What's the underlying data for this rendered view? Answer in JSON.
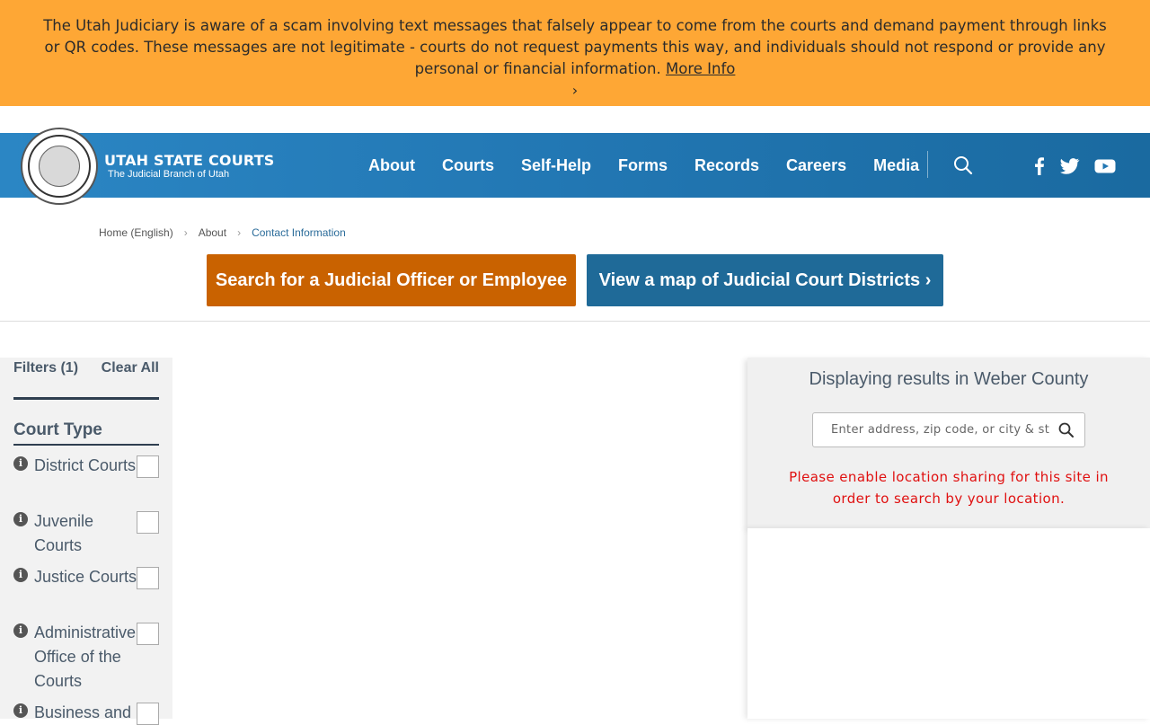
{
  "alert": {
    "message": "The Utah Judiciary is aware of a scam involving text messages that falsely appear to come from the courts and demand payment through links or QR codes. These messages are not legitimate - courts do not request payments this way, and individuals should not respond or provide any personal or financial information.",
    "link": "More Info",
    "chevron": "›"
  },
  "brand": {
    "title": "UTAH STATE COURTS",
    "subtitle": "The Judicial Branch of Utah"
  },
  "nav": {
    "items": [
      "About",
      "Courts",
      "Self-Help",
      "Forms",
      "Records",
      "Careers",
      "Media"
    ]
  },
  "breadcrumb": {
    "items": [
      "Home (English)",
      "About",
      "Contact Information"
    ]
  },
  "buttons": {
    "search_officer": "Search for a Judicial Officer or Employee",
    "view_map": "View a map of Judicial Court Districts ›"
  },
  "filters": {
    "header": "Filters (1)",
    "clear": "Clear All",
    "section_title": "Court Type",
    "options": [
      "District Courts",
      "Juvenile Courts",
      "Justice Courts",
      "Administrative Office of the Courts",
      "Business and"
    ]
  },
  "results": {
    "title": "Displaying results in Weber County",
    "placeholder": "Enter address, zip code, or city & st",
    "warning": "Please enable location sharing for this site in order to search by your location."
  },
  "colors": {
    "alert_bg": "#fea735",
    "header_bg": "#2277b3",
    "orange_button": "#c96200",
    "blue_button": "#1f6a98",
    "warning_text": "#e01010"
  }
}
